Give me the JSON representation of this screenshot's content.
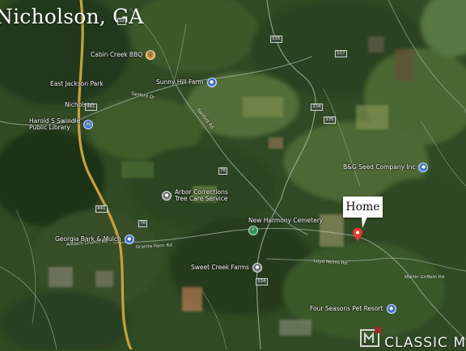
{
  "title": "Nicholson, GA",
  "colors": {
    "food_pin": "#f29a2e",
    "park_pin": "#2e9e5b",
    "blue_pin": "#4c8bf5",
    "gray_pin": "#8a8f95",
    "home_pin": "#e53935"
  },
  "places": [
    {
      "name": "cabin-creek-bbq",
      "label": "Cabin Creek BBQ",
      "icon": "restaurant-pin-icon",
      "color_key": "food_pin"
    },
    {
      "name": "east-jackson-park",
      "label": "East Jackson Park",
      "icon": "park-pin-icon",
      "color_key": "park_pin"
    },
    {
      "name": "nicholson",
      "label": "Nicholson",
      "icon": "",
      "color_key": ""
    },
    {
      "name": "harold-s-swindle-library",
      "label_lines": [
        "Harold S Swindle",
        "Public Library"
      ],
      "icon": "library-pin-icon",
      "color_key": "blue_pin"
    },
    {
      "name": "sunny-hill-farm",
      "label": "Sunny Hill Farm",
      "icon": "blue-pin-icon",
      "color_key": "blue_pin"
    },
    {
      "name": "bg-seed-company",
      "label": "B&G Seed Company Inc",
      "icon": "blue-pin-icon",
      "color_key": "blue_pin"
    },
    {
      "name": "arbor-corrections",
      "label_lines": [
        "Arbor Corrections",
        "Tree Care Service"
      ],
      "icon": "gray-pin-icon",
      "color_key": "gray_pin"
    },
    {
      "name": "new-harmony-cemetery",
      "label": "New Harmony Cemetery",
      "icon": "cemetery-pin-icon",
      "color_key": "park_pin"
    },
    {
      "name": "georgia-bark-mulch",
      "label": "Georgia Bark & Mulch",
      "icon": "blue-pin-icon",
      "color_key": "blue_pin"
    },
    {
      "name": "sweet-creek-farms",
      "label": "Sweet Creek Farms",
      "icon": "gray-pin-icon",
      "color_key": "gray_pin"
    },
    {
      "name": "four-seasons-pet-resort",
      "label": "Four Seasons Pet Resort",
      "icon": "blue-pin-icon",
      "color_key": "blue_pin"
    }
  ],
  "roads": [
    "52",
    "335",
    "441",
    "334",
    "157",
    "335",
    "76",
    "76",
    "441",
    "334"
  ],
  "streets": [
    "Sanford Dr",
    "Sanford Rd",
    "Loyd Nelms Rd",
    "Antioch Church Rd",
    "Granite Farm Rd",
    "Martin Griffeth Rd"
  ],
  "home_label": "Home",
  "logo_text": "CLASSIC M"
}
